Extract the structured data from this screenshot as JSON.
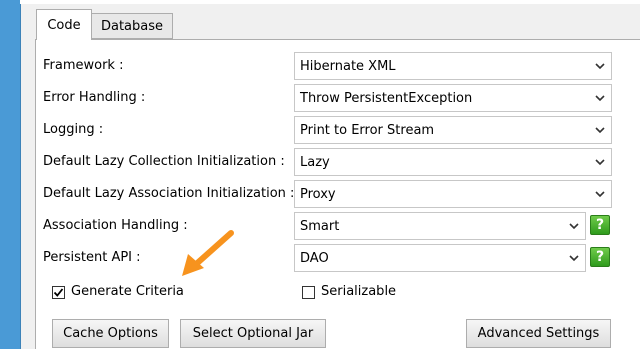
{
  "tabs": [
    {
      "label": "Code",
      "active": true
    },
    {
      "label": "Database",
      "active": false
    }
  ],
  "fields": [
    {
      "label": "Framework :",
      "value": "Hibernate XML",
      "help": false
    },
    {
      "label": "Error Handling :",
      "value": "Throw PersistentException",
      "help": false
    },
    {
      "label": "Logging :",
      "value": "Print to Error Stream",
      "help": false
    },
    {
      "label": "Default Lazy Collection Initialization :",
      "value": "Lazy",
      "help": false
    },
    {
      "label": "Default Lazy Association Initialization :",
      "value": "Proxy",
      "help": false
    },
    {
      "label": "Association Handling :",
      "value": "Smart",
      "help": true
    },
    {
      "label": "Persistent API :",
      "value": "DAO",
      "help": true
    }
  ],
  "help_glyph": "?",
  "checkboxes": [
    {
      "label": "Generate Criteria",
      "checked": true
    },
    {
      "label": "Serializable",
      "checked": false
    }
  ],
  "buttons": {
    "cache_options": "Cache Options",
    "select_optional_jar": "Select Optional Jar",
    "advanced_settings": "Advanced Settings"
  },
  "annotation": {
    "type": "arrow",
    "color": "#f7931e",
    "points_to": "Generate Criteria"
  },
  "colors": {
    "help_green": "#3aa52a",
    "window_strip": "#4a9ad6"
  }
}
